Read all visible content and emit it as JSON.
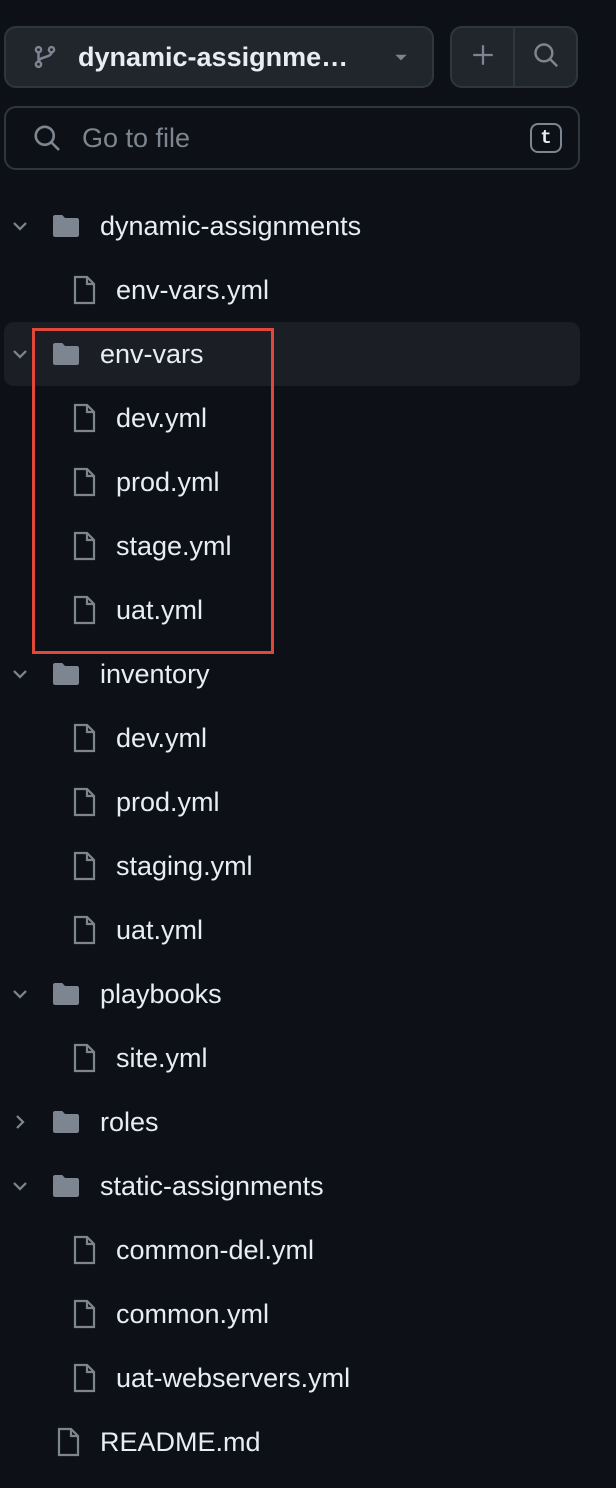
{
  "header": {
    "branch_label": "dynamic-assignme…",
    "branch_icon": "git-branch-icon",
    "caret_icon": "caret-down-icon",
    "add_icon": "plus-icon",
    "search_icon": "search-icon"
  },
  "search": {
    "placeholder": "Go to file",
    "shortcut": "t"
  },
  "colors": {
    "background": "#0d1117",
    "button_bg": "#21262d",
    "border": "#30363d",
    "icon": "#7d8590",
    "text": "#e6edf3",
    "active_row": "#1b1f25",
    "annotation": "#e2483a"
  },
  "tree": [
    {
      "type": "folder",
      "name": "dynamic-assignments",
      "expanded": true,
      "depth": 0
    },
    {
      "type": "file",
      "name": "env-vars.yml",
      "depth": 1
    },
    {
      "type": "folder",
      "name": "env-vars",
      "expanded": true,
      "depth": 0,
      "active": true
    },
    {
      "type": "file",
      "name": "dev.yml",
      "depth": 1
    },
    {
      "type": "file",
      "name": "prod.yml",
      "depth": 1
    },
    {
      "type": "file",
      "name": "stage.yml",
      "depth": 1
    },
    {
      "type": "file",
      "name": "uat.yml",
      "depth": 1
    },
    {
      "type": "folder",
      "name": "inventory",
      "expanded": true,
      "depth": 0
    },
    {
      "type": "file",
      "name": "dev.yml",
      "depth": 1
    },
    {
      "type": "file",
      "name": "prod.yml",
      "depth": 1
    },
    {
      "type": "file",
      "name": "staging.yml",
      "depth": 1
    },
    {
      "type": "file",
      "name": "uat.yml",
      "depth": 1
    },
    {
      "type": "folder",
      "name": "playbooks",
      "expanded": true,
      "depth": 0
    },
    {
      "type": "file",
      "name": "site.yml",
      "depth": 1
    },
    {
      "type": "folder",
      "name": "roles",
      "expanded": false,
      "depth": 0
    },
    {
      "type": "folder",
      "name": "static-assignments",
      "expanded": true,
      "depth": 0
    },
    {
      "type": "file",
      "name": "common-del.yml",
      "depth": 1
    },
    {
      "type": "file",
      "name": "common.yml",
      "depth": 1
    },
    {
      "type": "file",
      "name": "uat-webservers.yml",
      "depth": 1
    },
    {
      "type": "file",
      "name": "README.md",
      "depth": 0
    }
  ]
}
